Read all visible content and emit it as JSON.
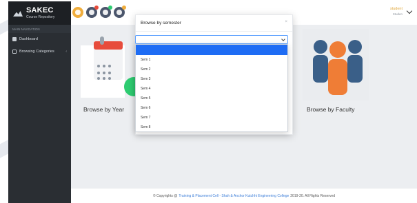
{
  "sidebar": {
    "brand_title": "SAKEC",
    "brand_subtitle": "Course Repository",
    "section_header": "MAIN NAVIGATION",
    "items": [
      {
        "label": "Dashboard",
        "icon": "dashboard-icon"
      },
      {
        "label": "Browsing Categories",
        "icon": "monitor-icon"
      }
    ]
  },
  "header": {
    "user_name": "student",
    "user_role": "Studen",
    "icons": [
      "menu-icon",
      "bell-icon",
      "drop-icon",
      "user-icon"
    ]
  },
  "tiles": [
    {
      "label": "Browse by Year",
      "icon": "calendar-icon"
    },
    {
      "label": "Browse by Faculty",
      "icon": "people-group-icon"
    }
  ],
  "modal": {
    "title": "Browse by semester",
    "close_glyph": "×",
    "selected_value": "",
    "options": [
      "",
      "Sem 1",
      "Sem 2",
      "Sem 3",
      "Sem 4",
      "Sem 5",
      "Sem 6",
      "Sem 7",
      "Sem 8"
    ]
  },
  "footer": {
    "prefix": "© Copyrights @",
    "link_text": "Training & Placement Cell - Shah & Anchor Kutchhi Engineering College",
    "suffix": "2019-20. All Rights Reserved"
  },
  "colors": {
    "sidebar_bg": "#2a2e33",
    "accent_orange": "#f0ad3c",
    "selected_option": "#1e6cf4",
    "link": "#3b7dd8"
  }
}
